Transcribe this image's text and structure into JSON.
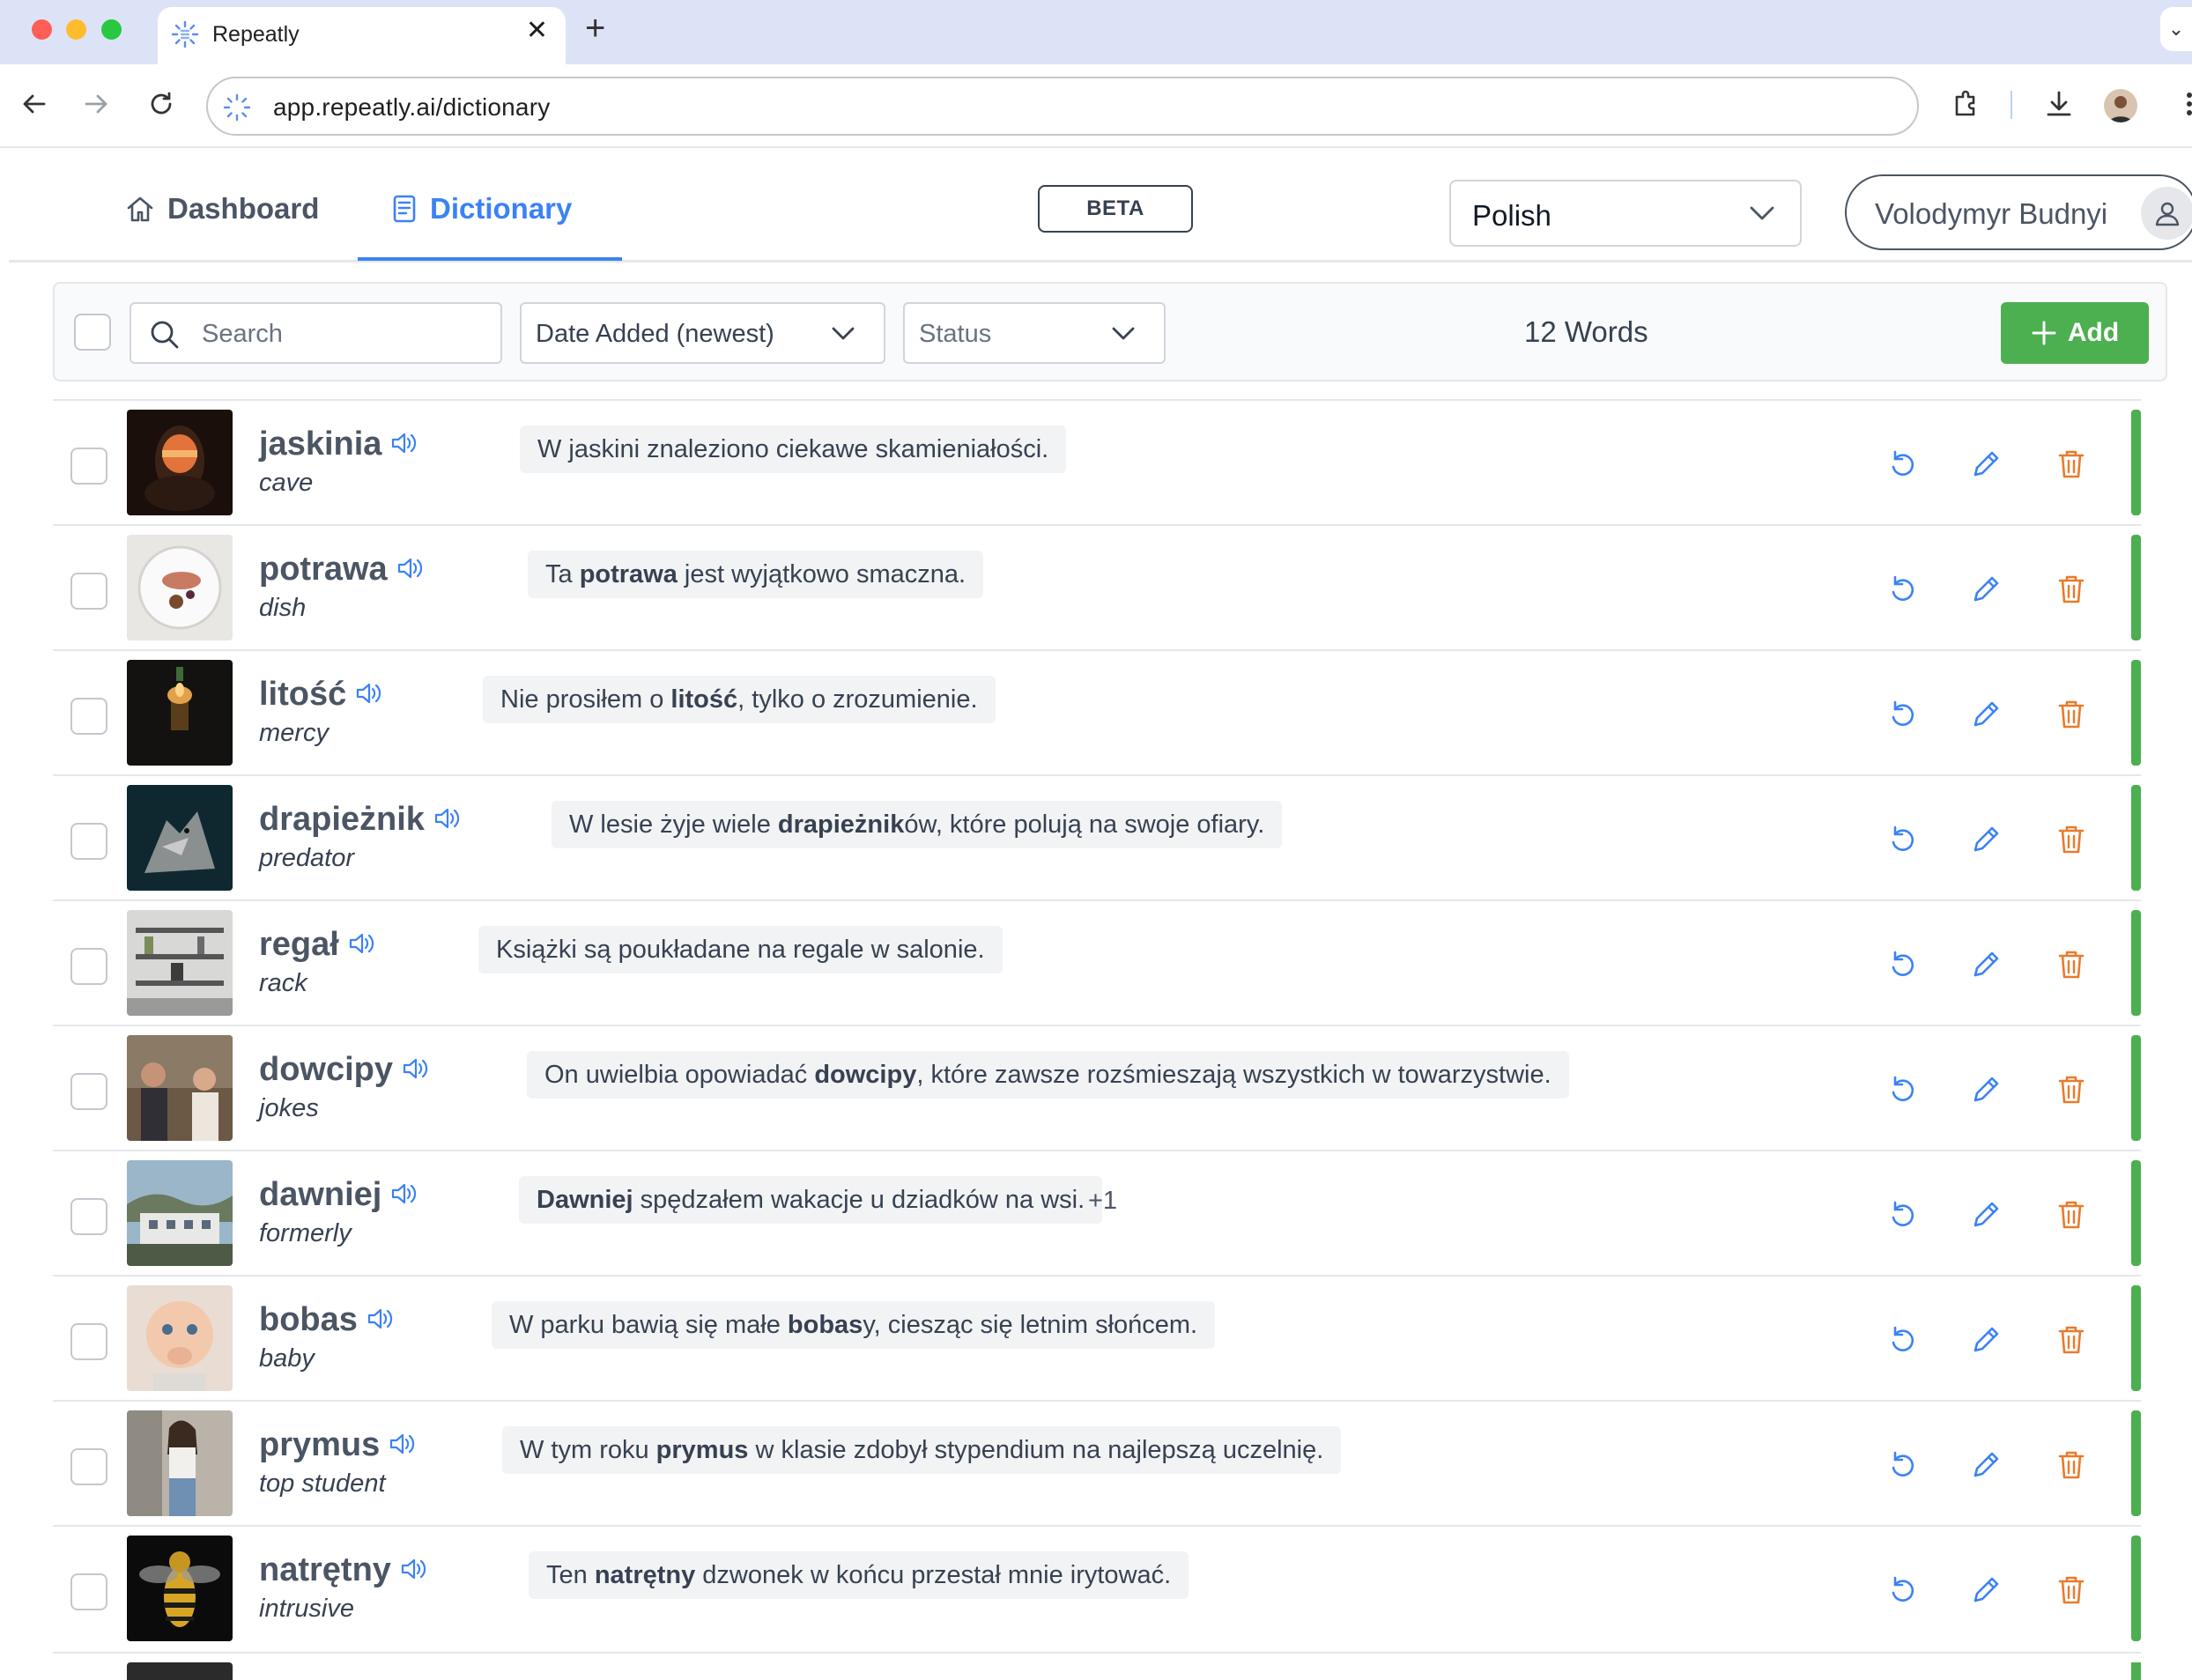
{
  "browser": {
    "tab_title": "Repeatly",
    "tab_close": "✕",
    "new_tab": "+",
    "url": "app.repeatly.ai/dictionary"
  },
  "app": {
    "nav": {
      "dashboard": "Dashboard",
      "dictionary": "Dictionary"
    },
    "beta": "BETA",
    "language": "Polish",
    "user_name": "Volodymyr Budnyi"
  },
  "filters": {
    "search_placeholder": "Search",
    "sort": "Date Added (newest)",
    "status": "Status",
    "count": "12 Words",
    "add_label": "Add"
  },
  "colors": {
    "accent": "#3b82f6",
    "success": "#4caf50",
    "danger": "#ea7a2c",
    "status_learned": "#4caf50"
  },
  "words": [
    {
      "word": "jaskinia",
      "translation": "cave",
      "example": [
        [
          "W jaskini znaleziono ciekawe skamieniałości.",
          false
        ]
      ],
      "extra": "",
      "image": "cave"
    },
    {
      "word": "potrawa",
      "translation": "dish",
      "example": [
        [
          "Ta ",
          false
        ],
        [
          "potrawa",
          true
        ],
        [
          " jest wyjątkowo smaczna.",
          false
        ]
      ],
      "extra": "",
      "image": "plate"
    },
    {
      "word": "litość",
      "translation": "mercy",
      "example": [
        [
          "Nie prosiłem o ",
          false
        ],
        [
          "litość",
          true
        ],
        [
          ", tylko o zrozumienie.",
          false
        ]
      ],
      "extra": "",
      "image": "candle"
    },
    {
      "word": "drapieżnik",
      "translation": "predator",
      "example": [
        [
          "W lesie żyje wiele ",
          false
        ],
        [
          "drapieżnik",
          true
        ],
        [
          "ów, które polują na swoje ofiary.",
          false
        ]
      ],
      "extra": "",
      "image": "wolf"
    },
    {
      "word": "regał",
      "translation": "rack",
      "example": [
        [
          "Książki są poukładane na regale w salonie.",
          false
        ]
      ],
      "extra": "",
      "image": "shelf"
    },
    {
      "word": "dowcipy",
      "translation": "jokes",
      "example": [
        [
          "On uwielbia opowiadać ",
          false
        ],
        [
          "dowcipy",
          true
        ],
        [
          ", które zawsze rozśmieszają wszystkich w towarzystwie.",
          false
        ]
      ],
      "extra": "",
      "image": "people"
    },
    {
      "word": "dawniej",
      "translation": "formerly",
      "example": [
        [
          "Dawniej",
          true
        ],
        [
          " spędzałem wakacje u dziadków na wsi.",
          false
        ]
      ],
      "extra": "+1",
      "image": "building"
    },
    {
      "word": "bobas",
      "translation": "baby",
      "example": [
        [
          "W parku bawią się małe ",
          false
        ],
        [
          "bobas",
          true
        ],
        [
          "y, ciesząc się letnim słońcem.",
          false
        ]
      ],
      "extra": "",
      "image": "baby"
    },
    {
      "word": "prymus",
      "translation": "top student",
      "example": [
        [
          "W tym roku ",
          false
        ],
        [
          "prymus",
          true
        ],
        [
          " w klasie zdobył stypendium na najlepszą uczelnię.",
          false
        ]
      ],
      "extra": "",
      "image": "woman"
    },
    {
      "word": "natrętny",
      "translation": "intrusive",
      "example": [
        [
          "Ten ",
          false
        ],
        [
          "natrętny",
          true
        ],
        [
          " dzwonek w końcu przestał mnie irytować.",
          false
        ]
      ],
      "extra": "",
      "image": "wasp"
    }
  ]
}
